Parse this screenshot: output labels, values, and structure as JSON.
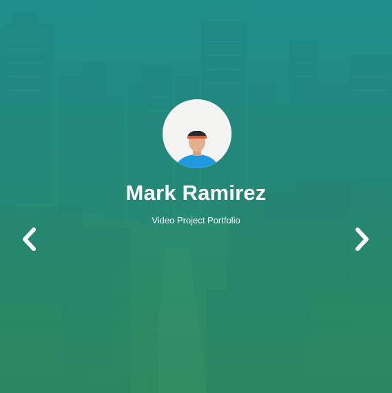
{
  "profile": {
    "name": "Mark Ramirez",
    "subtitle": "Video Project Portfolio"
  },
  "carousel": {
    "prev_icon": "chevron-left-icon",
    "next_icon": "chevron-right-icon"
  },
  "colors": {
    "overlay_top": "#1f8f8a",
    "overlay_bottom": "#2f8a5c",
    "text": "#ffffff",
    "avatar_bg": "#f4f4f2",
    "shirt": "#1e9be0"
  }
}
